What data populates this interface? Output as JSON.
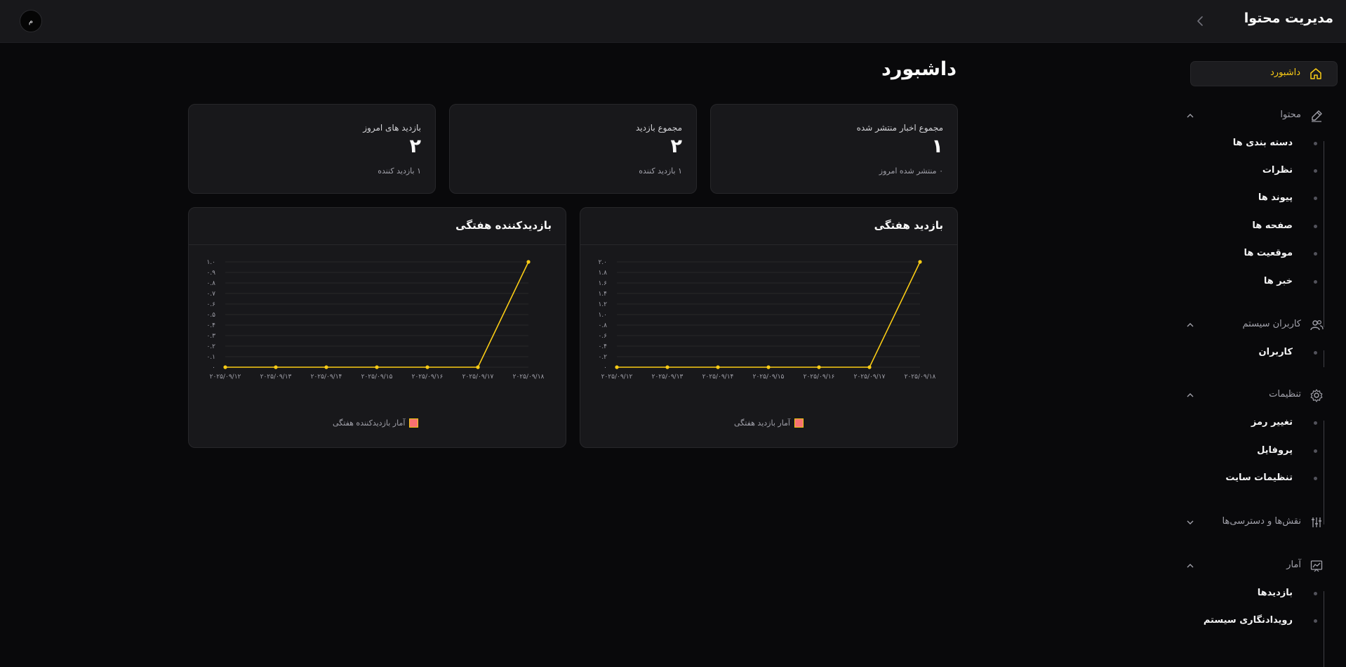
{
  "app": {
    "title": "مدیریت محتوا",
    "avatar_letter": "م"
  },
  "sidebar": {
    "dashboard": {
      "label": "داشبورد",
      "icon": "home-icon",
      "active_color": "#facc15"
    },
    "groups": [
      {
        "label": "محتوا",
        "icon": "edit-icon",
        "expanded": true,
        "items": [
          "دسته بندی ها",
          "نظرات",
          "پیوند ها",
          "صفحه ها",
          "موقعیت ها",
          "خبر ها"
        ]
      },
      {
        "label": "کاربران سیستم",
        "icon": "users-icon",
        "expanded": true,
        "items": [
          "کاربران"
        ]
      },
      {
        "label": "تنظیمات",
        "icon": "gear-icon",
        "expanded": true,
        "items": [
          "تغییر رمز",
          "پروفایل",
          "تنظیمات سایت"
        ]
      },
      {
        "label": "نقش‌ها و دسترسی‌ها",
        "icon": "sliders-icon",
        "expanded": false,
        "items": []
      },
      {
        "label": "آمار",
        "icon": "chart-icon",
        "expanded": true,
        "items": [
          "بازدیدها",
          "رویدادنگاری سیستم"
        ]
      }
    ]
  },
  "page": {
    "title": "داشبورد"
  },
  "stats": [
    {
      "title": "مجموع اخبار منتشر شده",
      "value": "۱",
      "sub": "۰ منتشر شده امروز"
    },
    {
      "title": "مجموع بازدید",
      "value": "۲",
      "sub": "۱ بازدید کننده"
    },
    {
      "title": "بازدید های امروز",
      "value": "۲",
      "sub": "۱ بازدید کننده"
    }
  ],
  "chart_data": [
    {
      "type": "line",
      "title": "بازدید هفتگی",
      "categories": [
        "۲۰۲۵/۰۹/۱۲",
        "۲۰۲۵/۰۹/۱۳",
        "۲۰۲۵/۰۹/۱۴",
        "۲۰۲۵/۰۹/۱۵",
        "۲۰۲۵/۰۹/۱۶",
        "۲۰۲۵/۰۹/۱۷",
        "۲۰۲۵/۰۹/۱۸"
      ],
      "series": [
        {
          "name": "آمار بازدید هفتگی",
          "values": [
            0,
            0,
            0,
            0,
            0,
            0,
            2
          ]
        }
      ],
      "ylim": [
        0,
        2
      ],
      "yticks": [
        "۰",
        "۰.۲",
        "۰.۴",
        "۰.۶",
        "۰.۸",
        "۱.۰",
        "۱.۲",
        "۱.۴",
        "۱.۶",
        "۱.۸",
        "۲.۰"
      ],
      "line_color": "#facc15",
      "grid": true,
      "legend": "bottom"
    },
    {
      "type": "line",
      "title": "بازدیدکننده هفتگی",
      "categories": [
        "۲۰۲۵/۰۹/۱۲",
        "۲۰۲۵/۰۹/۱۳",
        "۲۰۲۵/۰۹/۱۴",
        "۲۰۲۵/۰۹/۱۵",
        "۲۰۲۵/۰۹/۱۶",
        "۲۰۲۵/۰۹/۱۷",
        "۲۰۲۵/۰۹/۱۸"
      ],
      "series": [
        {
          "name": "آمار بازدیدکننده هفتگی",
          "values": [
            0,
            0,
            0,
            0,
            0,
            0,
            1
          ]
        }
      ],
      "ylim": [
        0,
        1
      ],
      "yticks": [
        "۰",
        "۰.۱",
        "۰.۲",
        "۰.۳",
        "۰.۴",
        "۰.۵",
        "۰.۶",
        "۰.۷",
        "۰.۸",
        "۰.۹",
        "۱.۰"
      ],
      "line_color": "#facc15",
      "grid": true,
      "legend": "bottom"
    }
  ]
}
